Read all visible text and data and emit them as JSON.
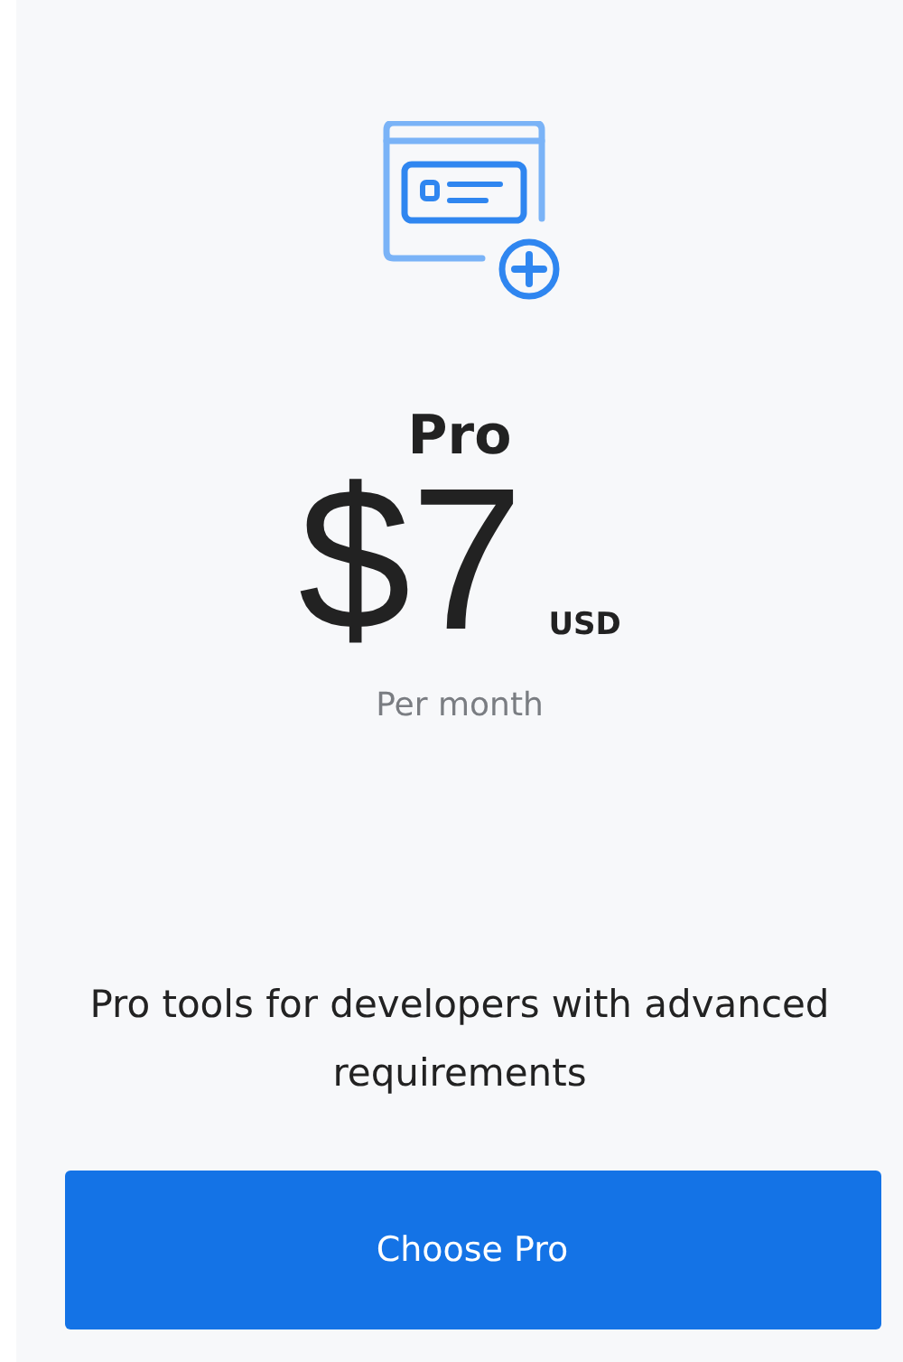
{
  "plan": {
    "name": "Pro",
    "price": "$7",
    "currency": "USD",
    "period": "Per month",
    "description": "Pro tools for developers with advanced requirements",
    "button": "Choose Pro"
  }
}
